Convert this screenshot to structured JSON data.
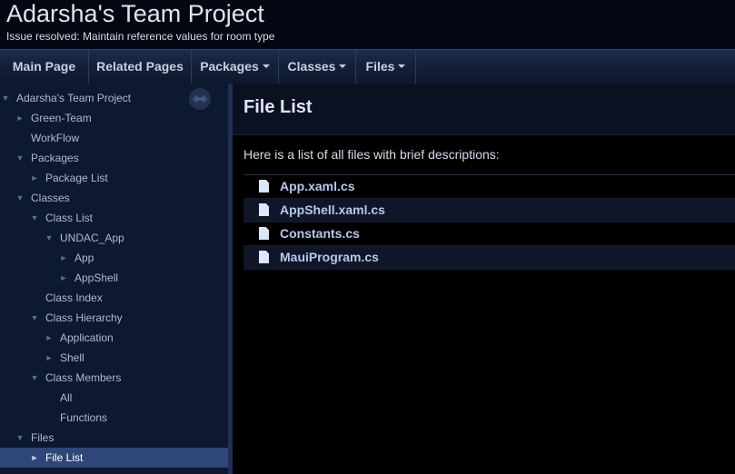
{
  "project": {
    "name": "Adarsha's Team Project",
    "brief": "Issue resolved: Maintain reference values for room type"
  },
  "nav": {
    "main_page": "Main Page",
    "related_pages": "Related Pages",
    "packages": "Packages",
    "classes": "Classes",
    "files": "Files"
  },
  "tree": {
    "root": "Adarsha's Team Project",
    "green_team": "Green-Team",
    "workflow": "WorkFlow",
    "packages": "Packages",
    "package_list": "Package List",
    "classes": "Classes",
    "class_list": "Class List",
    "undac_app": "UNDAC_App",
    "app": "App",
    "appshell": "AppShell",
    "class_index": "Class Index",
    "class_hierarchy": "Class Hierarchy",
    "application": "Application",
    "shell": "Shell",
    "class_members": "Class Members",
    "all": "All",
    "functions": "Functions",
    "files": "Files",
    "file_list": "File List"
  },
  "icons": {
    "sync": "sync-arrows-icon",
    "expanded": "triangle-down-icon",
    "collapsed": "triangle-right-icon",
    "file": "file-icon"
  },
  "content": {
    "title": "File List",
    "intro": "Here is a list of all files with brief descriptions:",
    "files": [
      {
        "name": "App.xaml.cs"
      },
      {
        "name": "AppShell.xaml.cs"
      },
      {
        "name": "Constants.cs"
      },
      {
        "name": "MauiProgram.cs"
      }
    ]
  },
  "colors": {
    "background": "#000000",
    "sidebar": "#0c1930",
    "selected": "#2f4678",
    "link": "#b7c7ec"
  }
}
